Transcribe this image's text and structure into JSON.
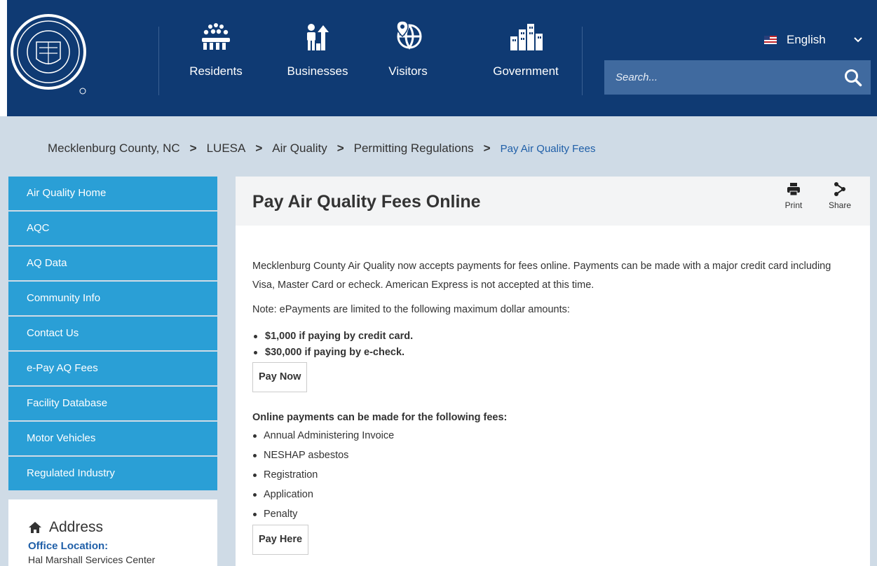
{
  "header": {
    "nav": [
      {
        "label": "Residents",
        "icon": "crowd-icon"
      },
      {
        "label": "Businesses",
        "icon": "business-growth-icon"
      },
      {
        "label": "Visitors",
        "icon": "globe-pin-icon"
      },
      {
        "label": "Government",
        "icon": "buildings-icon"
      }
    ],
    "language": "English",
    "search_placeholder": "Search...",
    "colors": {
      "header_bg": "#0f3a73",
      "search_bg": "#406a9f",
      "sidebar_bg": "#2a9fd6"
    }
  },
  "breadcrumb": [
    "Mecklenburg County, NC",
    "LUESA",
    "Air Quality",
    "Permitting Regulations",
    "Pay Air Quality Fees"
  ],
  "sidebar": {
    "items": [
      "Air Quality Home",
      "AQC",
      "AQ Data",
      "Community Info",
      "Contact Us",
      "e-Pay AQ Fees",
      "Facility Database",
      "Motor Vehicles",
      "Regulated Industry"
    ]
  },
  "address": {
    "title": "Address",
    "office_label": "Office Location:",
    "office_name": "Hal Marshall Services Center"
  },
  "main": {
    "title": "Pay Air Quality Fees Online",
    "tools": {
      "print": "Print",
      "share": "Share"
    },
    "intro": "Mecklenburg County Air Quality now accepts payments for fees online. Payments can be made with a major credit card including Visa, Master Card or echeck.  American Express is not accepted at this time.",
    "note": "Note:  ePayments are limited to the following maximum dollar amounts:",
    "limits": [
      "$1,000 if paying by credit card.",
      "$30,000 if paying by e-check."
    ],
    "pay_now": "Pay Now",
    "fees_heading": "Online payments can be made for the following fees:",
    "fees": [
      "Annual Administering Invoice",
      "NESHAP asbestos",
      "Registration",
      "Application",
      "Penalty"
    ],
    "pay_here": "Pay Here"
  }
}
